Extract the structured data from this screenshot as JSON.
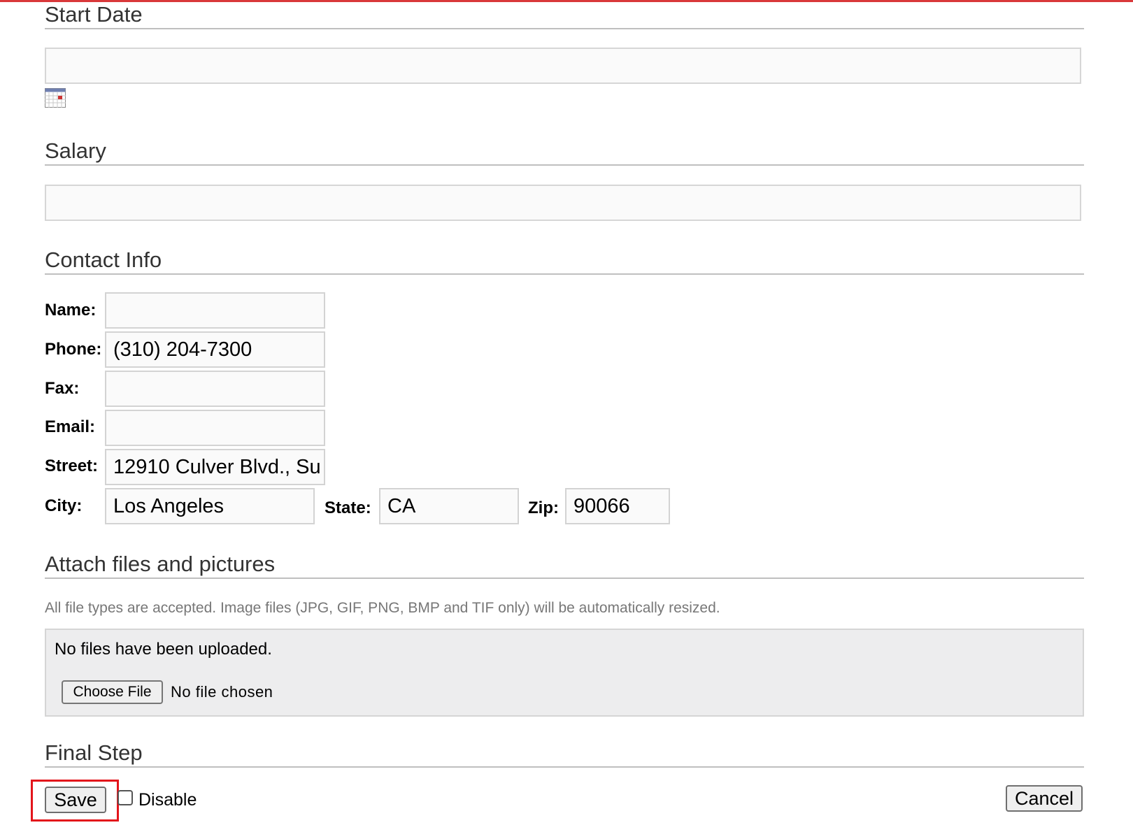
{
  "sections": {
    "start_date": "Start Date",
    "salary": "Salary",
    "contact_info": "Contact Info",
    "attachments": "Attach files and pictures",
    "final_step": "Final Step"
  },
  "start_date": {
    "value": ""
  },
  "salary": {
    "value": ""
  },
  "contact": {
    "name_label": "Name:",
    "name_value": "",
    "phone_label": "Phone:",
    "phone_value": "(310) 204-7300",
    "fax_label": "Fax:",
    "fax_value": "",
    "email_label": "Email:",
    "email_value": "",
    "street_label": "Street:",
    "street_value": "12910 Culver Blvd., Su",
    "city_label": "City:",
    "city_value": "Los Angeles",
    "state_label": "State:",
    "state_value": "CA",
    "zip_label": "Zip:",
    "zip_value": "90066"
  },
  "attachments": {
    "help_text": "All file types are accepted. Image files (JPG, GIF, PNG, BMP and TIF only) will be automatically resized.",
    "no_files_message": "No files have been uploaded.",
    "choose_file_label": "Choose File",
    "no_file_chosen": "No file chosen"
  },
  "final_step": {
    "save_label": "Save",
    "disable_label": "Disable",
    "cancel_label": "Cancel",
    "disable_checked": false
  },
  "colors": {
    "top_bar": "#d9383a",
    "highlight": "#e3151b"
  },
  "icons": {
    "calendar": "calendar-icon"
  }
}
